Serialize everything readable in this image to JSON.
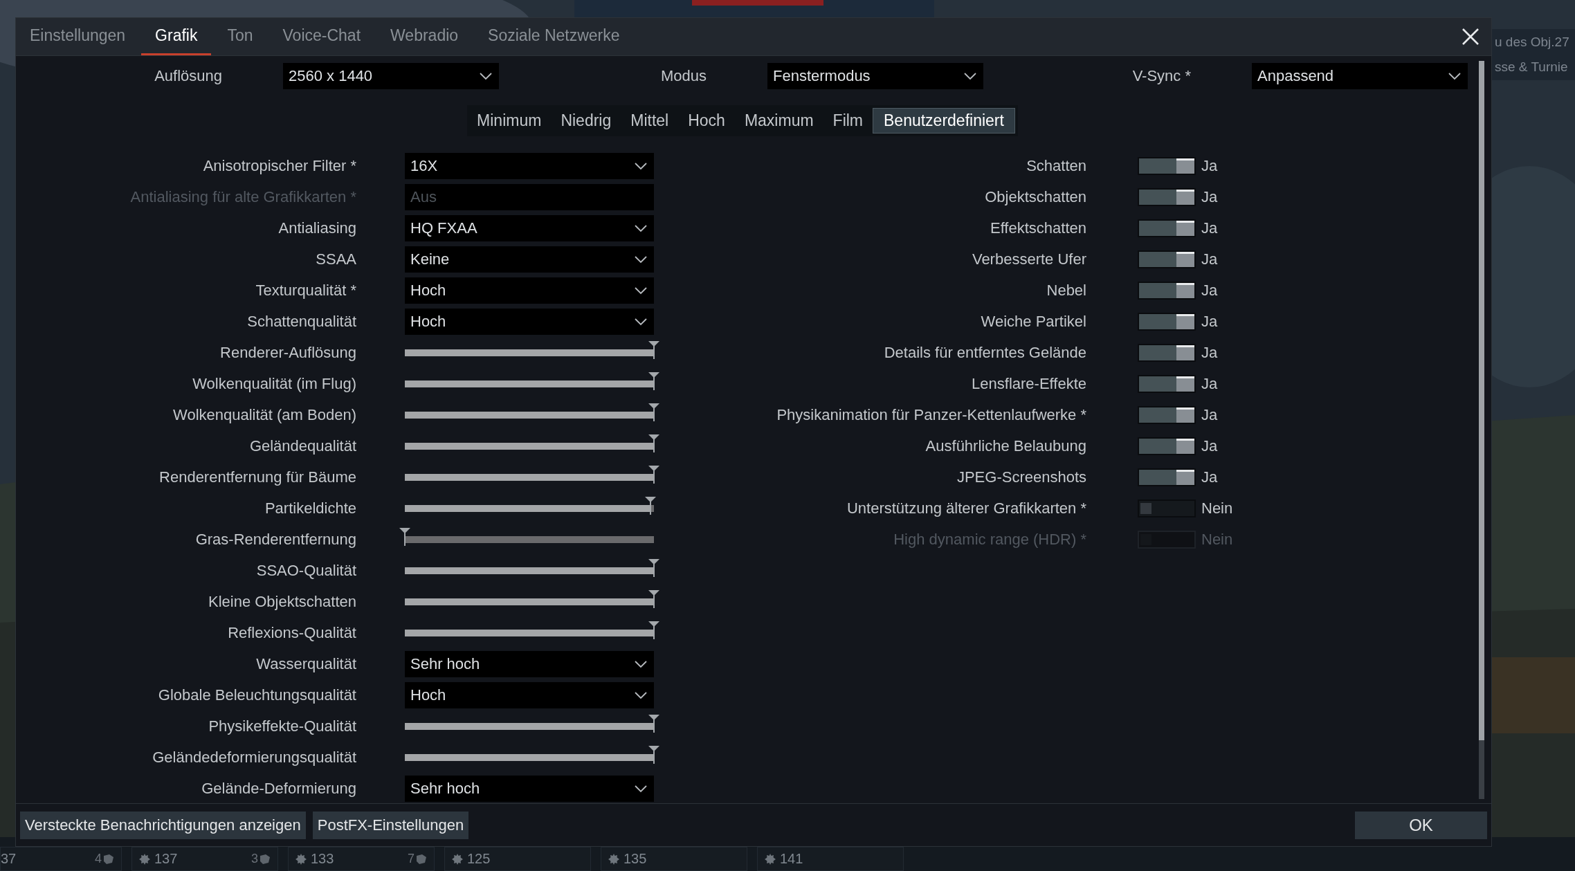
{
  "background": {
    "kind": "picture",
    "side_panel": [
      "u des Obj.27",
      "sse & Turnie"
    ],
    "vehicle_cards": [
      {
        "number": "37",
        "badge": "4"
      },
      {
        "number": "137",
        "badge": "3"
      },
      {
        "number": "133",
        "badge": "7"
      },
      {
        "number": "125"
      },
      {
        "number": "135"
      },
      {
        "number": "141"
      }
    ]
  },
  "dialog": {
    "tabs": [
      {
        "label": "Einstellungen",
        "selected": false
      },
      {
        "label": "Grafik",
        "selected": true
      },
      {
        "label": "Ton",
        "selected": false
      },
      {
        "label": "Voice-Chat",
        "selected": false
      },
      {
        "label": "Webradio",
        "selected": false
      },
      {
        "label": "Soziale Netzwerke",
        "selected": false
      }
    ],
    "display": [
      {
        "label": "Auflösung",
        "value": "2560 x 1440"
      },
      {
        "label": "Modus",
        "value": "Fenstermodus"
      },
      {
        "label": "V-Sync *",
        "value": "Anpassend"
      }
    ],
    "presets": [
      {
        "label": "Minimum",
        "selected": false
      },
      {
        "label": "Niedrig",
        "selected": false
      },
      {
        "label": "Mittel",
        "selected": false
      },
      {
        "label": "Hoch",
        "selected": false
      },
      {
        "label": "Maximum",
        "selected": false
      },
      {
        "label": "Film",
        "selected": false
      },
      {
        "label": "Benutzerdefiniert",
        "selected": true
      }
    ],
    "settings_left": [
      {
        "kind": "dropdown",
        "label": "Anisotropischer Filter *",
        "value": "16X",
        "disabled": false
      },
      {
        "kind": "dropdown",
        "label": "Antialiasing für alte Grafikkarten *",
        "value": "Aus",
        "disabled": true
      },
      {
        "kind": "dropdown",
        "label": "Antialiasing",
        "value": "HQ FXAA",
        "disabled": false
      },
      {
        "kind": "dropdown",
        "label": "SSAA",
        "value": "Keine",
        "disabled": false
      },
      {
        "kind": "dropdown",
        "label": "Texturqualität *",
        "value": "Hoch",
        "disabled": false
      },
      {
        "kind": "dropdown",
        "label": "Schattenqualität",
        "value": "Hoch",
        "disabled": false
      },
      {
        "kind": "slider",
        "label": "Renderer-Auflösung",
        "level": 1
      },
      {
        "kind": "slider",
        "label": "Wolkenqualität (im Flug)",
        "level": 1
      },
      {
        "kind": "slider",
        "label": "Wolkenqualität (am Boden)",
        "level": 1
      },
      {
        "kind": "slider",
        "label": "Geländequalität",
        "level": 1
      },
      {
        "kind": "slider",
        "label": "Renderentfernung für Bäume",
        "level": 1
      },
      {
        "kind": "slider",
        "label": "Partikeldichte",
        "level": 0.985
      },
      {
        "kind": "slider",
        "label": "Gras-Renderentfernung",
        "level": 0
      },
      {
        "kind": "slider",
        "label": "SSAO-Qualität",
        "level": 1
      },
      {
        "kind": "slider",
        "label": "Kleine Objektschatten",
        "level": 1
      },
      {
        "kind": "slider",
        "label": "Reflexions-Qualität",
        "level": 1
      },
      {
        "kind": "dropdown",
        "label": "Wasserqualität",
        "value": "Sehr hoch",
        "disabled": false
      },
      {
        "kind": "dropdown",
        "label": "Globale Beleuchtungsqualität",
        "value": "Hoch",
        "disabled": false
      },
      {
        "kind": "slider",
        "label": "Physikeffekte-Qualität",
        "level": 1
      },
      {
        "kind": "slider",
        "label": "Geländedeformierungsqualität",
        "level": 1
      },
      {
        "kind": "dropdown",
        "label": "Gelände-Deformierung",
        "value": "Sehr hoch",
        "disabled": false
      }
    ],
    "settings_right": [
      {
        "label": "Schatten",
        "on": true,
        "value": "Ja",
        "disabled": false
      },
      {
        "label": "Objektschatten",
        "on": true,
        "value": "Ja",
        "disabled": false
      },
      {
        "label": "Effektschatten",
        "on": true,
        "value": "Ja",
        "disabled": false
      },
      {
        "label": "Verbesserte Ufer",
        "on": true,
        "value": "Ja",
        "disabled": false
      },
      {
        "label": "Nebel",
        "on": true,
        "value": "Ja",
        "disabled": false
      },
      {
        "label": "Weiche Partikel",
        "on": true,
        "value": "Ja",
        "disabled": false
      },
      {
        "label": "Details für entferntes Gelände",
        "on": true,
        "value": "Ja",
        "disabled": false
      },
      {
        "label": "Lensflare-Effekte",
        "on": true,
        "value": "Ja",
        "disabled": false
      },
      {
        "label": "Physikanimation für Panzer-Kettenlaufwerke *",
        "on": true,
        "value": "Ja",
        "disabled": false
      },
      {
        "label": "Ausführliche Belaubung",
        "on": true,
        "value": "Ja",
        "disabled": false
      },
      {
        "label": "JPEG-Screenshots",
        "on": true,
        "value": "Ja",
        "disabled": false
      },
      {
        "label": "Unterstützung älterer Grafikkarten *",
        "on": false,
        "value": "Nein",
        "disabled": false
      },
      {
        "label": "High dynamic range (HDR) *",
        "on": false,
        "value": "Nein",
        "disabled": true
      }
    ],
    "footer_buttons": [
      "Versteckte Benachrichtigungen anzeigen",
      "PostFX-Einstellungen"
    ],
    "ok_button": "OK"
  }
}
